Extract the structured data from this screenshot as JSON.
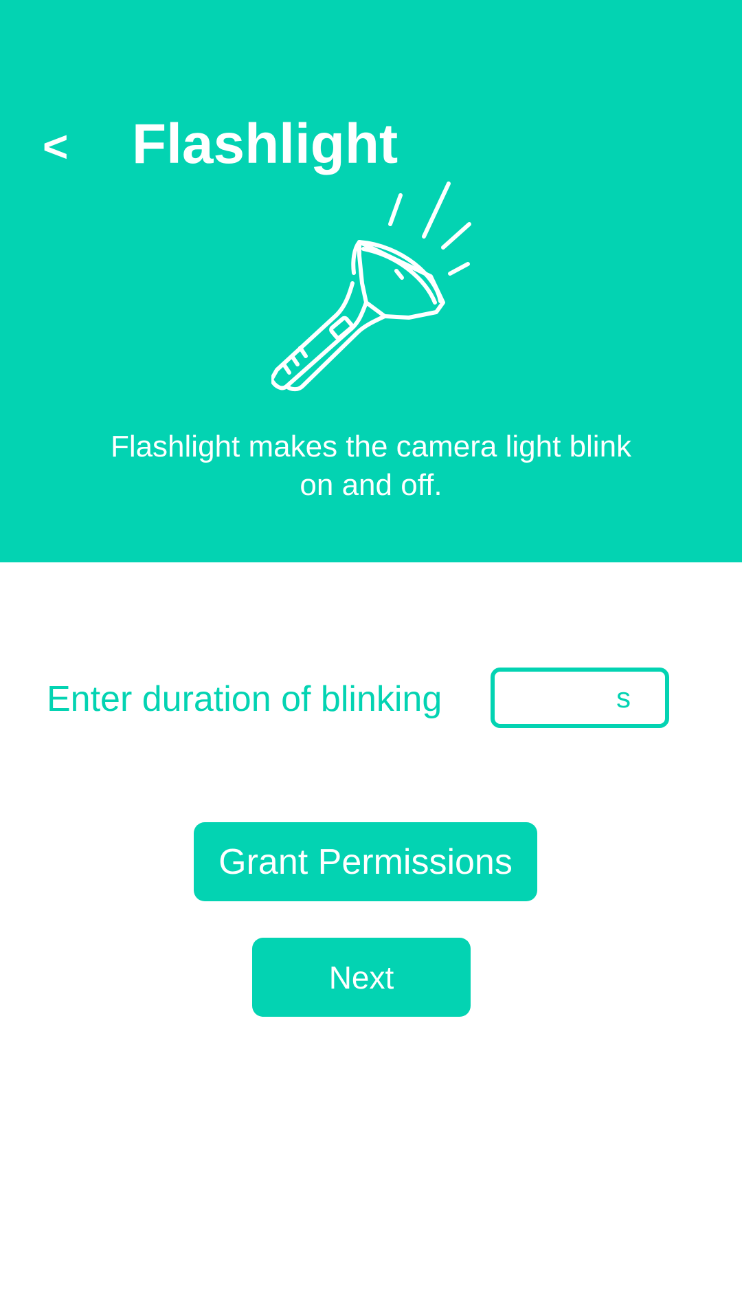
{
  "header": {
    "back_label": "<",
    "title": "Flashlight",
    "illustration_icon": "flashlight-icon",
    "description": "Flashlight makes the camera light blink on and off."
  },
  "form": {
    "duration_label": "Enter duration of blinking",
    "duration_value": "",
    "duration_unit": "s"
  },
  "actions": {
    "grant_label": "Grant Permissions",
    "next_label": "Next"
  },
  "colors": {
    "accent": "#03D3B2",
    "background": "#FFFFFF",
    "text_on_accent": "#FFFFFF"
  }
}
